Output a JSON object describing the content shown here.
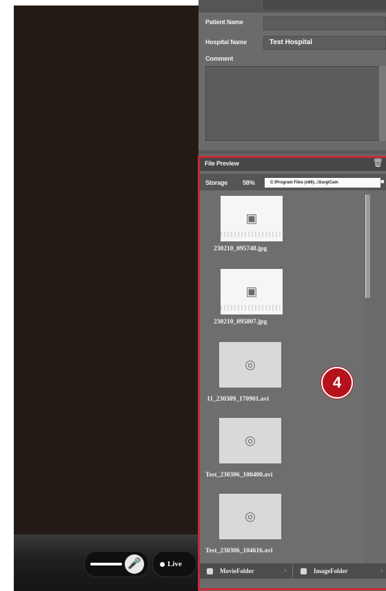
{
  "patient_info": {
    "patient_name_label": "Patient Name",
    "patient_name_value": "",
    "hospital_name_label": "Hospital Name",
    "hospital_name_value": "Test Hospital",
    "comment_label": "Comment",
    "comment_value": ""
  },
  "file_preview": {
    "title": "File Preview",
    "storage_label": "Storage",
    "storage_percent": "58%",
    "storage_path": "C:\\Program Files (x86)...\\SurgiCam",
    "files": [
      {
        "name": "230210_095748.jpg",
        "kind": "image",
        "icon": "camera-icon"
      },
      {
        "name": "230210_095807.jpg",
        "kind": "image",
        "icon": "camera-icon"
      },
      {
        "name": "11_230309_170901.avi",
        "kind": "video",
        "icon": "play-icon"
      },
      {
        "name": "Test_230306_100400.avi",
        "kind": "video",
        "icon": "play-icon"
      },
      {
        "name": "Test_230306_104616.avi",
        "kind": "video",
        "icon": "play-icon"
      }
    ],
    "movie_folder_label": "MovieFolder",
    "image_folder_label": "ImageFolder"
  },
  "controls": {
    "live_label": "Live"
  },
  "callout": {
    "number": "4",
    "color": "#c62a34"
  }
}
